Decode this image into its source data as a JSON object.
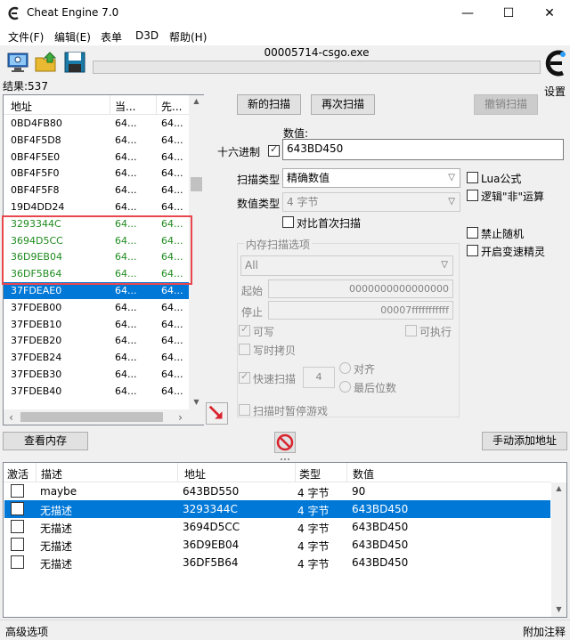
{
  "window": {
    "title": "Cheat Engine 7.0",
    "minimize": "—",
    "maximize": "☐",
    "close": "✕"
  },
  "menu": [
    "文件(F)",
    "编辑(E)",
    "表单",
    "D3D",
    "帮助(H)"
  ],
  "toolbar": {
    "process_name": "00005714-csgo.exe",
    "settings_label": "设置",
    "icons": [
      "open-process-icon",
      "open-file-icon",
      "save-icon"
    ]
  },
  "found": {
    "results_label": "结果:537",
    "columns": [
      "地址",
      "当...",
      "先..."
    ],
    "rows": [
      {
        "addr": "0BD4FB80",
        "cur": "64...",
        "prev": "64..."
      },
      {
        "addr": "0BF4F5D8",
        "cur": "64...",
        "prev": "64..."
      },
      {
        "addr": "0BF4F5E0",
        "cur": "64...",
        "prev": "64..."
      },
      {
        "addr": "0BF4F5F0",
        "cur": "64...",
        "prev": "64..."
      },
      {
        "addr": "0BF4F5F8",
        "cur": "64...",
        "prev": "64..."
      },
      {
        "addr": "19D4DD24",
        "cur": "64...",
        "prev": "64..."
      },
      {
        "addr": "3293344C",
        "cur": "64...",
        "prev": "64..."
      },
      {
        "addr": "3694D5CC",
        "cur": "64...",
        "prev": "64..."
      },
      {
        "addr": "36D9EB04",
        "cur": "64...",
        "prev": "64..."
      },
      {
        "addr": "36DF5B64",
        "cur": "64...",
        "prev": "64..."
      },
      {
        "addr": "37FDEAE0",
        "cur": "64...",
        "prev": "64..."
      },
      {
        "addr": "37FDEB00",
        "cur": "64...",
        "prev": "64..."
      },
      {
        "addr": "37FDEB10",
        "cur": "64...",
        "prev": "64..."
      },
      {
        "addr": "37FDEB20",
        "cur": "64...",
        "prev": "64..."
      },
      {
        "addr": "37FDEB24",
        "cur": "64...",
        "prev": "64..."
      },
      {
        "addr": "37FDEB30",
        "cur": "64...",
        "prev": "64..."
      },
      {
        "addr": "37FDEB40",
        "cur": "64...",
        "prev": "64..."
      }
    ],
    "highlight_color": "#e8474e",
    "green_color": "#1f8b1f",
    "selected_color": "#0078d7"
  },
  "scan": {
    "new_scan": "新的扫描",
    "next_scan": "再次扫描",
    "undo_scan": "撤销扫描",
    "value_label": "数值:",
    "hex_label": "十六进制",
    "value": "643BD450",
    "scan_type_label": "扫描类型",
    "scan_type": "精确数值",
    "value_type_label": "数值类型",
    "value_type": "4 字节",
    "compare_first": "对比首次扫描",
    "lua_formula": "Lua公式",
    "not_logic": "逻辑\"非\"运算",
    "disable_random": "禁止随机",
    "speedhack": "开启变速精灵"
  },
  "memory": {
    "title": "内存扫描选项",
    "region": "All",
    "start_label": "起始",
    "start_value": "0000000000000000",
    "stop_label": "停止",
    "stop_value": "00007fffffffffff",
    "writable": "可写",
    "executable": "可执行",
    "copy_on_write": "写时拷贝",
    "fast_scan": "快速扫描",
    "fast_scan_value": "4",
    "align": "对齐",
    "last_digits": "最后位数",
    "pause_game": "扫描时暂停游戏"
  },
  "actions": {
    "view_memory": "查看内存",
    "add_address": "手动添加地址"
  },
  "address_list": {
    "columns": [
      "激活",
      "描述",
      "地址",
      "类型",
      "数值"
    ],
    "rows": [
      {
        "desc": "maybe",
        "addr": "643BD550",
        "type": "4 字节",
        "value": "90"
      },
      {
        "desc": "无描述",
        "addr": "3293344C",
        "type": "4 字节",
        "value": "643BD450"
      },
      {
        "desc": "无描述",
        "addr": "3694D5CC",
        "type": "4 字节",
        "value": "643BD450"
      },
      {
        "desc": "无描述",
        "addr": "36D9EB04",
        "type": "4 字节",
        "value": "643BD450"
      },
      {
        "desc": "无描述",
        "addr": "36DF5B64",
        "type": "4 字节",
        "value": "643BD450"
      }
    ]
  },
  "status": {
    "advanced": "高级选项",
    "comments": "附加注释"
  }
}
